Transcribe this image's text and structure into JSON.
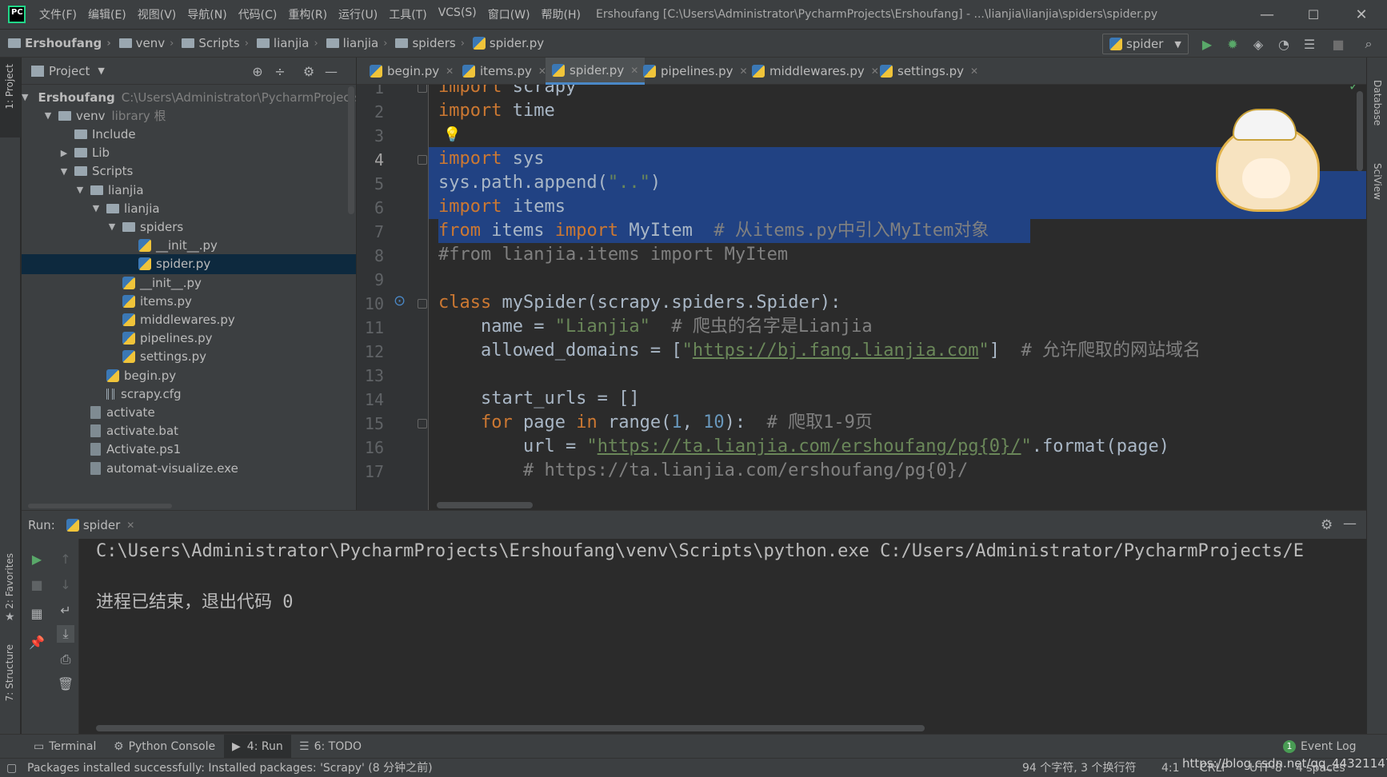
{
  "menu": [
    "文件(F)",
    "编辑(E)",
    "视图(V)",
    "导航(N)",
    "代码(C)",
    "重构(R)",
    "运行(U)",
    "工具(T)",
    "VCS(S)",
    "窗口(W)",
    "帮助(H)"
  ],
  "window_title": "Ershoufang [C:\\Users\\Administrator\\PycharmProjects\\Ershoufang] - ...\\lianjia\\lianjia\\spiders\\spider.py",
  "window_controls": {
    "minimize": "—",
    "maximize": "☐",
    "close": "✕"
  },
  "breadcrumb": [
    "Ershoufang",
    "venv",
    "Scripts",
    "lianjia",
    "lianjia",
    "spiders",
    "spider.py"
  ],
  "run_config": {
    "label": "spider"
  },
  "project_panel": {
    "title": "Project",
    "tree": [
      {
        "label": "Ershoufang",
        "extra": "C:\\Users\\Administrator\\PycharmProjects",
        "type": "folder",
        "depth": 0,
        "expanded": true
      },
      {
        "label": "venv",
        "extra": "library 根",
        "type": "folder",
        "depth": 1,
        "expanded": true
      },
      {
        "label": "Include",
        "type": "folder",
        "depth": 2
      },
      {
        "label": "Lib",
        "type": "folder",
        "depth": 2,
        "collapsed": true
      },
      {
        "label": "Scripts",
        "type": "folder",
        "depth": 2,
        "expanded": true
      },
      {
        "label": "lianjia",
        "type": "folder",
        "depth": 3,
        "expanded": true
      },
      {
        "label": "lianjia",
        "type": "folder",
        "depth": 4,
        "expanded": true
      },
      {
        "label": "spiders",
        "type": "folder",
        "depth": 5,
        "expanded": true
      },
      {
        "label": "__init__.py",
        "type": "py",
        "depth": 6
      },
      {
        "label": "spider.py",
        "type": "py",
        "depth": 6,
        "selected": true
      },
      {
        "label": "__init__.py",
        "type": "py",
        "depth": 5
      },
      {
        "label": "items.py",
        "type": "py",
        "depth": 5
      },
      {
        "label": "middlewares.py",
        "type": "py",
        "depth": 5
      },
      {
        "label": "pipelines.py",
        "type": "py",
        "depth": 5
      },
      {
        "label": "settings.py",
        "type": "py",
        "depth": 5
      },
      {
        "label": "begin.py",
        "type": "py",
        "depth": 4
      },
      {
        "label": "scrapy.cfg",
        "type": "cfg",
        "depth": 4
      },
      {
        "label": "activate",
        "type": "file",
        "depth": 3
      },
      {
        "label": "activate.bat",
        "type": "file",
        "depth": 3
      },
      {
        "label": "Activate.ps1",
        "type": "file",
        "depth": 3
      },
      {
        "label": "automat-visualize.exe",
        "type": "file",
        "depth": 3
      }
    ]
  },
  "editor_tabs": [
    {
      "label": "begin.py"
    },
    {
      "label": "items.py"
    },
    {
      "label": "spider.py",
      "active": true
    },
    {
      "label": "pipelines.py"
    },
    {
      "label": "middlewares.py"
    },
    {
      "label": "settings.py"
    }
  ],
  "code": {
    "line_numbers": [
      "1",
      "2",
      "3",
      "4",
      "5",
      "6",
      "7",
      "8",
      "9",
      "10",
      "11",
      "12",
      "13",
      "14",
      "15",
      "16",
      "17"
    ],
    "lines": [
      [
        [
          "kw",
          "import"
        ],
        [
          "",
          " scrapy"
        ]
      ],
      [
        [
          "kw",
          "import"
        ],
        [
          "",
          " time"
        ]
      ],
      [],
      [
        [
          "kw",
          "import"
        ],
        [
          "",
          " sys"
        ]
      ],
      [
        [
          "",
          "sys.path.append("
        ],
        [
          "str",
          "\"..\""
        ],
        [
          "",
          ")"
        ]
      ],
      [
        [
          "kw",
          "import"
        ],
        [
          "",
          " items"
        ]
      ],
      [
        [
          "kw",
          "from"
        ],
        [
          "",
          " items "
        ],
        [
          "kw",
          "import"
        ],
        [
          "",
          " MyItem  "
        ],
        [
          "cmt",
          "# 从items.py中引入MyItem对象"
        ]
      ],
      [
        [
          "cmt",
          "#from lianjia.items import MyItem"
        ]
      ],
      [],
      [
        [
          "kw",
          "class"
        ],
        [
          "",
          " mySpider(scrapy.spiders.Spider):"
        ]
      ],
      [
        [
          "",
          "    name = "
        ],
        [
          "str",
          "\"Lianjia\""
        ],
        [
          "",
          "  "
        ],
        [
          "cmt",
          "# 爬虫的名字是Lianjia"
        ]
      ],
      [
        [
          "",
          "    allowed_domains = ["
        ],
        [
          "str",
          "\""
        ],
        [
          "url",
          "https://bj.fang.lianjia.com"
        ],
        [
          "str",
          "\""
        ],
        [
          "",
          "]  "
        ],
        [
          "cmt",
          "# 允许爬取的网站域名"
        ]
      ],
      [],
      [
        [
          "",
          "    start_urls = []"
        ]
      ],
      [
        [
          "kw",
          "    for"
        ],
        [
          "",
          " page "
        ],
        [
          "kw",
          "in"
        ],
        [
          "",
          " range("
        ],
        [
          "num",
          "1"
        ],
        [
          "",
          ", "
        ],
        [
          "num",
          "10"
        ],
        [
          "",
          "):  "
        ],
        [
          "cmt",
          "# 爬取1-9页"
        ]
      ],
      [
        [
          "",
          "        url = "
        ],
        [
          "str",
          "\""
        ],
        [
          "url",
          "https://ta.lianjia.com/ershoufang/pg{0}/"
        ],
        [
          "str",
          "\""
        ],
        [
          "",
          ".format(page)"
        ]
      ],
      [
        [
          "cmt",
          "        # https://ta.lianjia.com/ershoufang/pg{0}/"
        ]
      ]
    ]
  },
  "right_stripe": [
    "Database",
    "SciView"
  ],
  "left_stripe": [
    "1: Project",
    "2: Favorites",
    "7: Structure"
  ],
  "run_panel": {
    "label": "Run:",
    "tab": "spider",
    "console": [
      "C:\\Users\\Administrator\\PycharmProjects\\Ershoufang\\venv\\Scripts\\python.exe C:/Users/Administrator/PycharmProjects/E",
      "",
      "进程已结束，退出代码 0"
    ]
  },
  "toolwindow_bar": [
    {
      "label": "Terminal",
      "icon": "terminal-icon"
    },
    {
      "label": "Python Console",
      "icon": "python-console-icon"
    },
    {
      "label": "4: Run",
      "icon": "run-icon",
      "active": true
    },
    {
      "label": "6: TODO",
      "icon": "todo-icon"
    }
  ],
  "event_log": {
    "count": "1",
    "label": "Event Log"
  },
  "status": {
    "message": "Packages installed successfully: Installed packages: 'Scrapy' (8 分钟之前)",
    "selection": "94 个字符, 3 个换行符",
    "position": "4:1",
    "line_sep": "CRLF",
    "encoding": "UTF-8",
    "indent": "4 spaces",
    "watermark": "https://blog.csdn.net/qq_44321147"
  }
}
